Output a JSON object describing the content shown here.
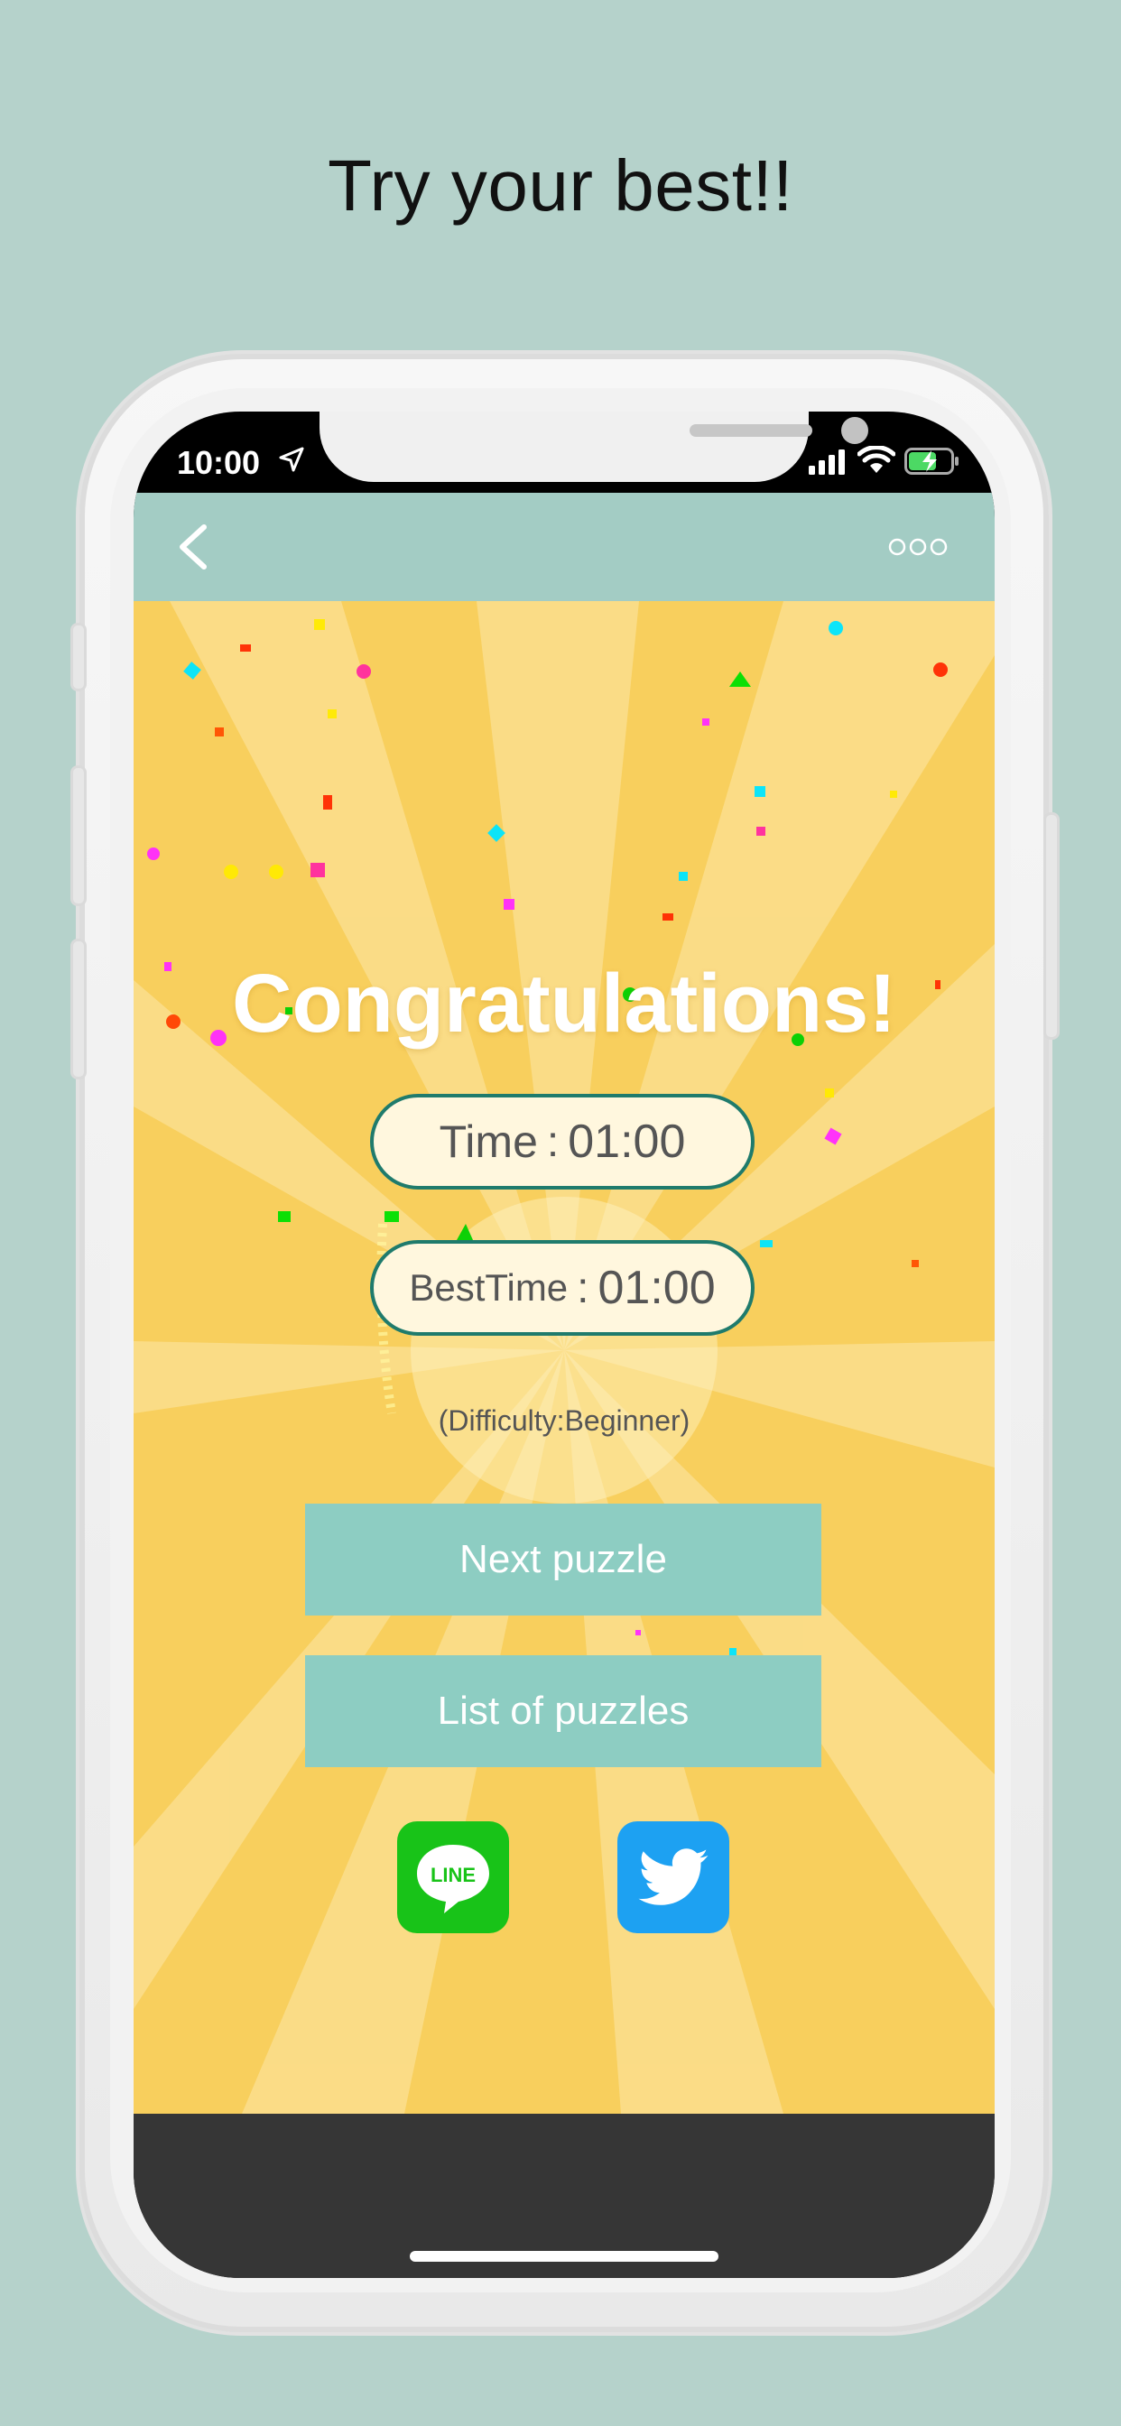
{
  "headline": "Try your best!!",
  "status_bar": {
    "time": "10:00"
  },
  "navbar": {
    "back_icon": "chevron-left-icon",
    "more_icon": "ellipsis-circles-icon"
  },
  "result": {
    "title": "Congratulations!",
    "time_label": "Time",
    "time_value": "01:00",
    "best_label": "BestTime",
    "best_value": "01:00",
    "separator": ":",
    "difficulty": "(Difficulty:Beginner)"
  },
  "buttons": {
    "next": "Next puzzle",
    "list": "List of puzzles"
  },
  "share": {
    "line_label": "LINE",
    "line_icon": "line-app-icon",
    "twitter_icon": "twitter-bird-icon"
  },
  "colors": {
    "page_bg": "#b5d2cb",
    "navbar": "#a3ccc4",
    "content_bg": "#f8cf5d",
    "button": "#8dcdc2",
    "pill_border": "#1f7b6c",
    "line_green": "#18c318",
    "twitter_blue": "#1da1f2",
    "bottom_bar": "#363636"
  }
}
